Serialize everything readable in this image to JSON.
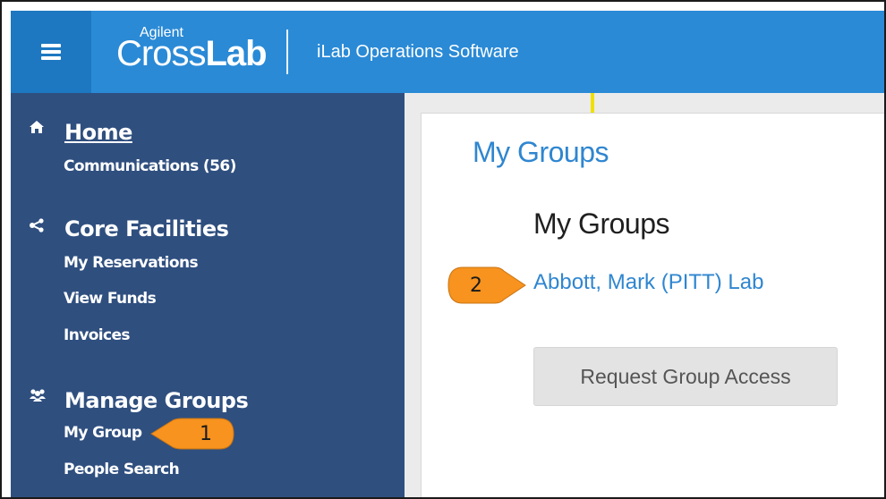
{
  "header": {
    "brand_small": "Agilent",
    "brand_cross": "Cross",
    "brand_lab": "Lab",
    "app_title": "iLab Operations Software"
  },
  "sidebar": {
    "home": {
      "icon": "home-icon",
      "title": "Home",
      "items": [
        "Communications (56)"
      ]
    },
    "core": {
      "icon": "share-icon",
      "title": "Core Facilities",
      "items": [
        "My Reservations",
        "View Funds",
        "Invoices"
      ]
    },
    "groups": {
      "icon": "users-icon",
      "title": "Manage Groups",
      "items": [
        "My Group",
        "People Search"
      ]
    }
  },
  "main": {
    "page_title": "My Groups",
    "section_title": "My Groups",
    "group_link": "Abbott, Mark (PITT) Lab",
    "request_button": "Request Group Access"
  },
  "callouts": {
    "one": "1",
    "two": "2",
    "color": "#f7931e"
  },
  "colors": {
    "topbar": "#2a8ad6",
    "sidebar": "#2f4f7f",
    "link": "#2f86d0"
  }
}
